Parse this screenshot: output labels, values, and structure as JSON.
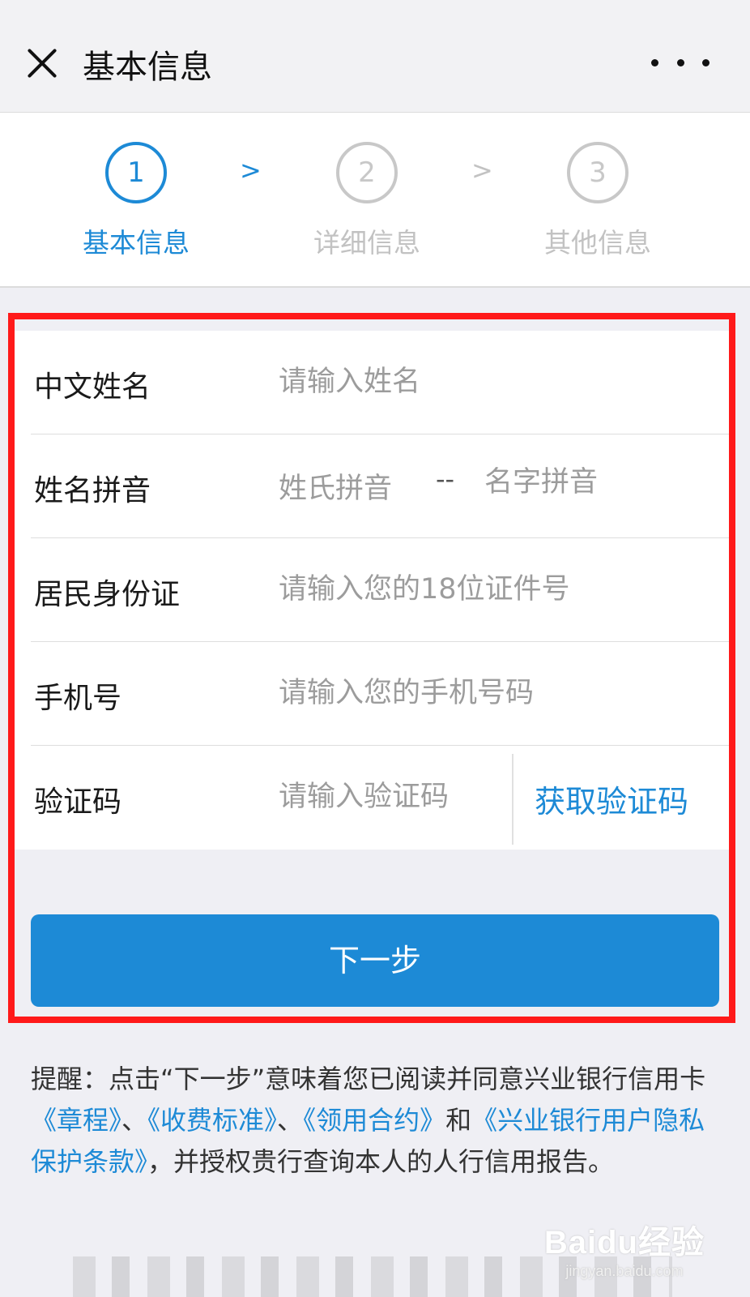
{
  "header": {
    "title": "基本信息"
  },
  "stepper": {
    "steps": [
      {
        "number": "1",
        "label": "基本信息"
      },
      {
        "number": "2",
        "label": "详细信息"
      },
      {
        "number": "3",
        "label": "其他信息"
      }
    ],
    "arrow": ">",
    "active_step": 1
  },
  "form": {
    "name": {
      "label": "中文姓名",
      "placeholder": "请输入姓名"
    },
    "pinyin": {
      "label": "姓名拼音",
      "last_placeholder": "姓氏拼音",
      "separator": "--",
      "first_placeholder": "名字拼音"
    },
    "id_card": {
      "label": "居民身份证",
      "placeholder": "请输入您的18位证件号"
    },
    "phone": {
      "label": "手机号",
      "placeholder": "请输入您的手机号码"
    },
    "code": {
      "label": "验证码",
      "placeholder": "请输入验证码",
      "get_code_label": "获取验证码"
    }
  },
  "next_button": {
    "label": "下一步"
  },
  "notice": {
    "prefix": "提醒：点击“下一步”意味着您已阅读并同意兴业银行信用卡",
    "link1": "《章程》",
    "sep1": "、",
    "link2": "《收费标准》",
    "sep2": "、",
    "link3": "《领用合约》",
    "and": "和",
    "link4": "《兴业银行用户隐私保护条款》",
    "suffix": "，并授权贵行查询本人的人行信用报告。"
  },
  "watermark": {
    "main": "Baidu经验",
    "sub": "jingyan.baidu.com"
  },
  "colors": {
    "accent": "#1d8ad6",
    "highlight": "#ff1a1a",
    "inactive": "#c2c2c2"
  }
}
